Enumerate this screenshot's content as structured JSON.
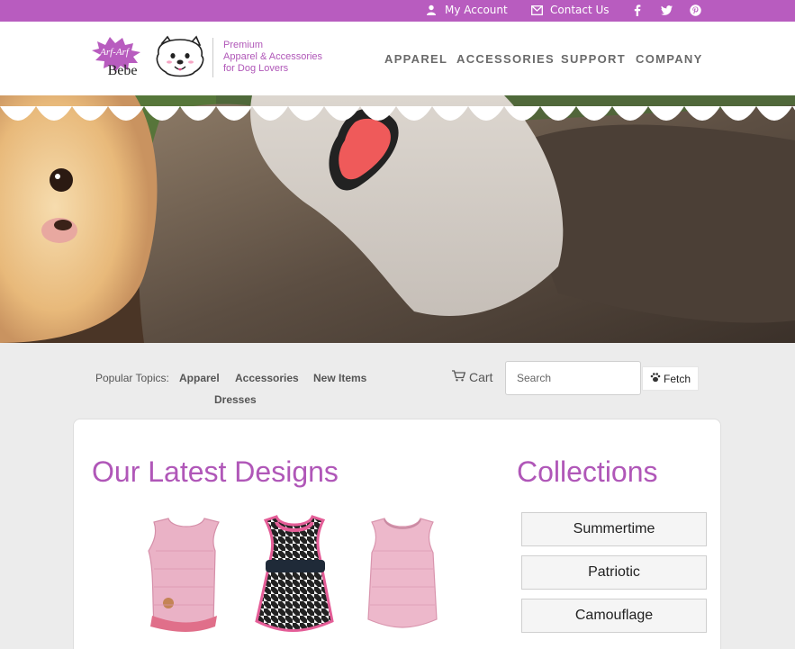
{
  "topbar": {
    "my_account": "My Account",
    "contact_us": "Contact Us",
    "social": [
      "facebook-icon",
      "twitter-icon",
      "pinterest-icon"
    ]
  },
  "brand": {
    "logo_line1": "Arf-Arf",
    "logo_line2": "Bebe",
    "tagline": [
      "Premium",
      "Apparel & Accessories",
      "for Dog Lovers"
    ]
  },
  "nav": [
    "APPAREL",
    "ACCESSORIES",
    "SUPPORT",
    "COMPANY"
  ],
  "search_row": {
    "popular_label": "Popular Topics:",
    "topics": [
      "Apparel",
      "Accessories",
      "New Items",
      "Dresses"
    ],
    "cart_label": "Cart",
    "search_placeholder": "Search",
    "fetch_label": "Fetch"
  },
  "main": {
    "latest_title": "Our Latest Designs",
    "collections_title": "Collections",
    "collections": [
      "Summertime",
      "Patriotic",
      "Camouflage"
    ]
  },
  "colors": {
    "brand_purple": "#b85cbf",
    "heading_purple": "#b057b8"
  }
}
